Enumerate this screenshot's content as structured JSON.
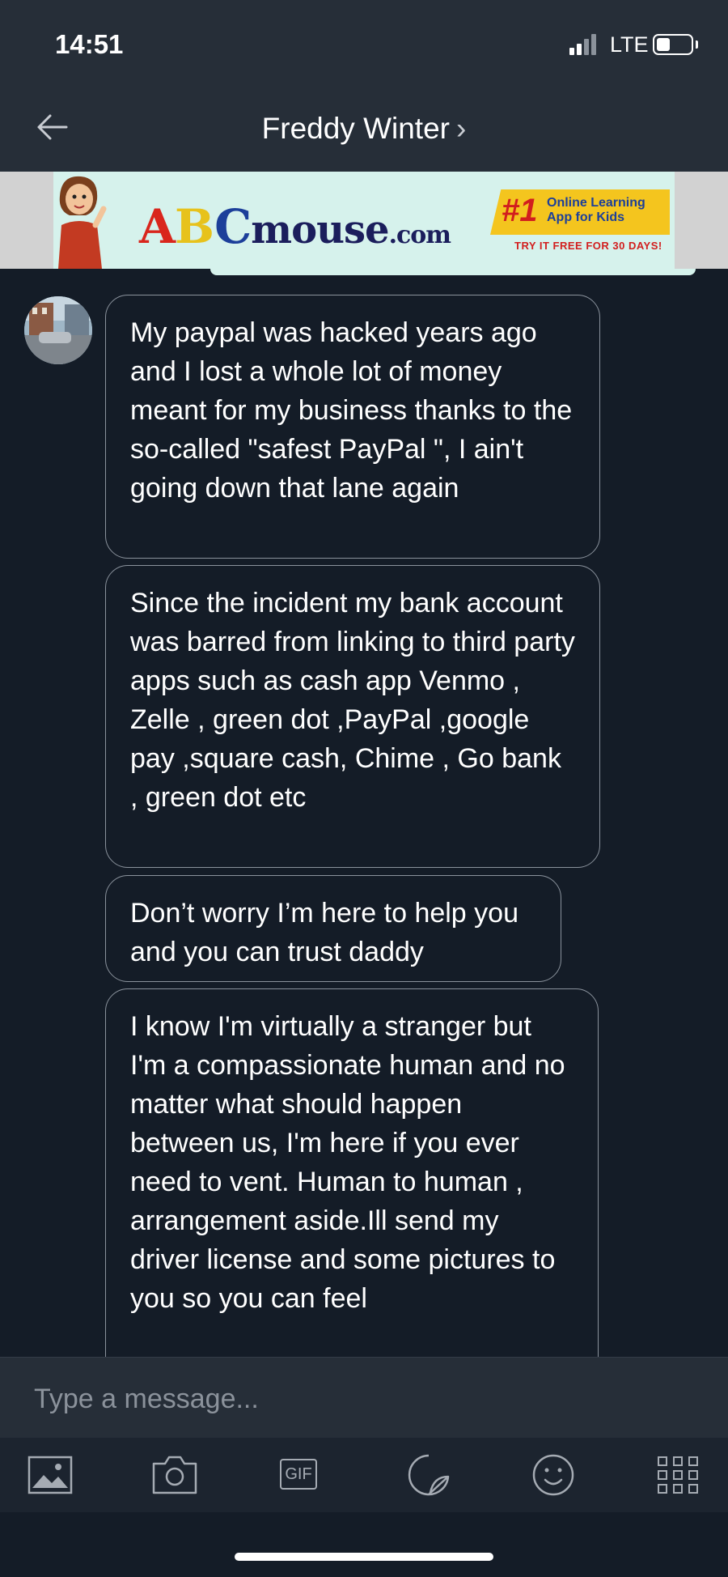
{
  "status_bar": {
    "time": "14:51",
    "network": "LTE",
    "icons": [
      "signal-icon",
      "battery-icon"
    ]
  },
  "nav": {
    "title": "Freddy Winter",
    "chevron": "›",
    "back_icon": "back-arrow-icon"
  },
  "ad": {
    "logo_a": "A",
    "logo_b": "B",
    "logo_c": "C",
    "logo_rest": "mouse",
    "logo_com": ".com",
    "rank": "#1",
    "badge_text": "Online Learning App for Kids",
    "cta": "TRY IT FREE FOR 30 DAYS!",
    "colors": {
      "background": "#d6f2ec",
      "red": "#d9261c",
      "yellow": "#f4c51e",
      "navy": "#1b1e5c"
    }
  },
  "messages": [
    {
      "text": "My paypal was hacked years ago and I lost a whole lot of money meant for my business thanks to the so-called \"safest PayPal \", I ain't going down that lane again"
    },
    {
      "text": "Since the incident my bank account was barred from linking to third party apps such as cash app Venmo , Zelle , green dot ,PayPal ,google  pay ,square cash, Chime  , Go bank , green dot etc"
    },
    {
      "text": "Don’t worry I’m here to help you and you can trust daddy"
    },
    {
      "text": "I know I'm virtually a stranger but I'm a compassionate human and no matter what should happen between us, I'm here if you ever need to vent. Human to human , arrangement aside.Ill send my driver license and some pictures to you so you can feel"
    }
  ],
  "composer": {
    "placeholder": "Type a message..."
  },
  "toolbar": {
    "gif_label": "GIF",
    "icons": [
      "image-icon",
      "camera-icon",
      "gif-icon",
      "sticker-icon",
      "emoji-icon",
      "apps-grid-icon"
    ]
  },
  "colors": {
    "background": "#141c27",
    "header": "#262e38",
    "bubble_border": "#8a929c",
    "text": "#ffffff"
  }
}
